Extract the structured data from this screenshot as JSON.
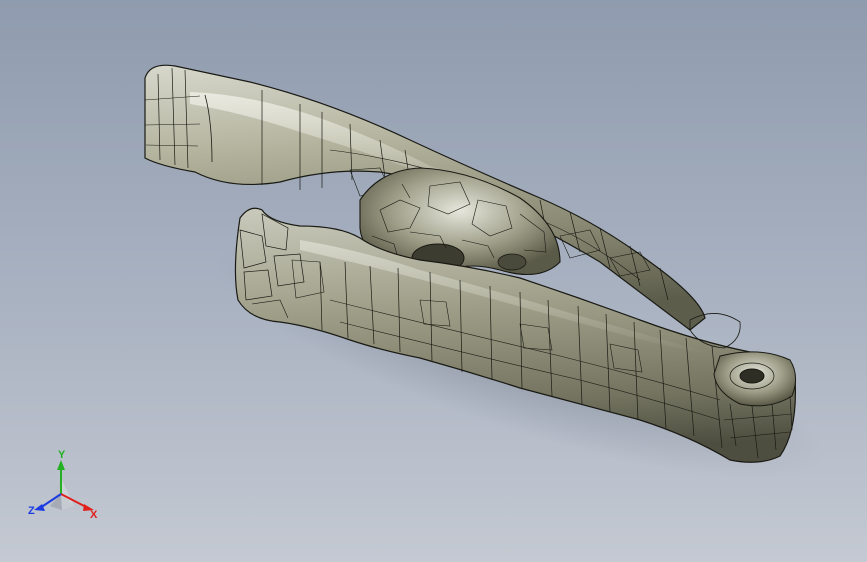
{
  "viewport": {
    "background_top": "#8f9bae",
    "background_bottom": "#c4c9d2",
    "model_color": "#9c9c82",
    "edge_color": "#1a1a14"
  },
  "triad": {
    "x_label": "X",
    "y_label": "Y",
    "z_label": "Z",
    "x_color": "#e0201c",
    "y_color": "#23b023",
    "z_color": "#1c3be0"
  }
}
